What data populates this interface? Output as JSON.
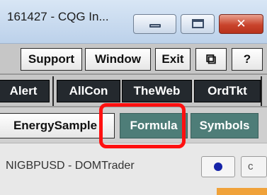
{
  "window": {
    "title": "161427 - CQG In...",
    "close_symbol": "✕"
  },
  "toolbar_top": {
    "support": "Support",
    "window": "Window",
    "exit": "Exit",
    "restore_icon": "⧉",
    "help": "?"
  },
  "toolbar_apps": [
    "Alert",
    "AllCon",
    "TheWeb",
    "OrdTkt"
  ],
  "toolbar_pages": [
    "EnergySample",
    "Formula",
    "Symbols"
  ],
  "dom": {
    "title": "NIGBPUSD - DOMTrader",
    "c_label": "c"
  },
  "colors": {
    "highlight": "#ff1010",
    "formula_bg": "#4e7d78",
    "dot": "#1523a8"
  }
}
